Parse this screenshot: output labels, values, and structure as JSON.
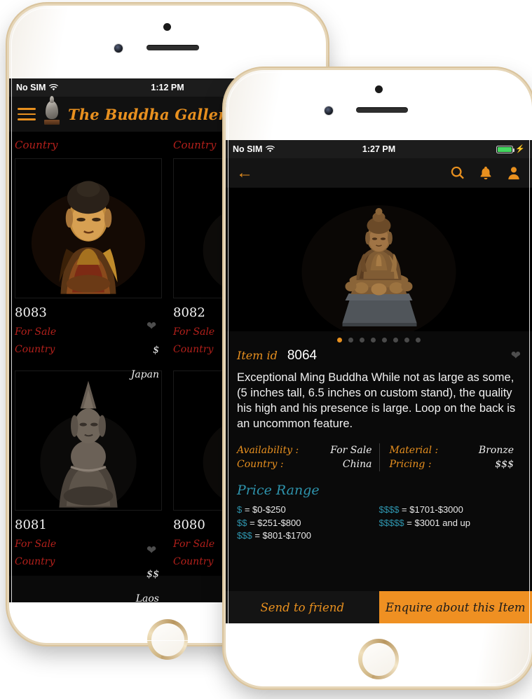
{
  "colors": {
    "accent_orange": "#e8901f",
    "label_red": "#b3201b",
    "teal": "#2e94ad",
    "screen_black": "#0a0a0a",
    "battery_green": "#44d860",
    "heart_gray": "#4d4d4d"
  },
  "gallery_phone": {
    "status_bar": {
      "carrier": "No SIM",
      "wifi_icon": "wifi-icon",
      "time": "1:12 PM"
    },
    "header": {
      "menu_icon": "hamburger-menu-icon",
      "logo_icon": "buddha-head-logo-icon",
      "brand": "The Buddha Gallery"
    },
    "items": [
      {
        "country_label": "Country",
        "image_alt": "gilt-lacquer-japanese-buddha",
        "id": "8083",
        "favorite_icon": "heart-icon",
        "availability_label": "For Sale",
        "price": "$",
        "country_key": "Country",
        "country_value": "Japan"
      },
      {
        "country_label": "Country",
        "image_alt": "buddha-statue-clipped",
        "id": "8082",
        "favorite_icon": "heart-icon",
        "availability_label": "For Sale",
        "price": "",
        "country_key": "Country",
        "country_value": ""
      },
      {
        "country_label": "Country",
        "image_alt": "laotian-stone-buddha",
        "id": "8081",
        "favorite_icon": "heart-icon",
        "availability_label": "For Sale",
        "price": "$$",
        "country_key": "Country",
        "country_value": "Laos"
      },
      {
        "country_label": "Country",
        "image_alt": "buddha-statue-clipped",
        "id": "8080",
        "favorite_icon": "heart-icon",
        "availability_label": "For Sale",
        "price": "",
        "country_key": "Country",
        "country_value": ""
      }
    ]
  },
  "detail_phone": {
    "status_bar": {
      "carrier": "No SIM",
      "wifi_icon": "wifi-icon",
      "time": "1:27 PM",
      "battery_icon": "battery-full-icon",
      "charging_icon": "lightning-bolt-icon"
    },
    "nav": {
      "back_icon": "back-arrow-icon",
      "search_icon": "search-icon",
      "notifications_icon": "bell-icon",
      "profile_icon": "person-icon"
    },
    "carousel": {
      "image_alt": "ming-bronze-buddha-on-stone-base",
      "dot_count": 8,
      "active_dot": 1
    },
    "item": {
      "id_label": "Item id",
      "id_value": "8064",
      "favorite_icon": "heart-icon",
      "description": "Exceptional Ming Buddha While not as large as some, (5 inches tall, 6.5 inches on custom stand), the quality his high and his presence is large. Loop on the back is an uncommon feature."
    },
    "attributes": {
      "left": [
        {
          "key": "Availability :",
          "value": "For Sale"
        },
        {
          "key": "Country :",
          "value": "China"
        }
      ],
      "right": [
        {
          "key": "Material :",
          "value": "Bronze"
        },
        {
          "key": "Pricing :",
          "value": "$$$"
        }
      ]
    },
    "price_range": {
      "title": "Price Range",
      "left": [
        {
          "symbol": "$",
          "text": " = $0-$250"
        },
        {
          "symbol": "$$",
          "text": " = $251-$800"
        },
        {
          "symbol": "$$$",
          "text": " = $801-$1700"
        }
      ],
      "right": [
        {
          "symbol": "$$$$",
          "text": " = $1701-$3000"
        },
        {
          "symbol": "$$$$$",
          "text": " = $3001 and up"
        }
      ]
    },
    "actions": {
      "send_to_friend": "Send to friend",
      "enquire": "Enquire about this Item"
    }
  }
}
